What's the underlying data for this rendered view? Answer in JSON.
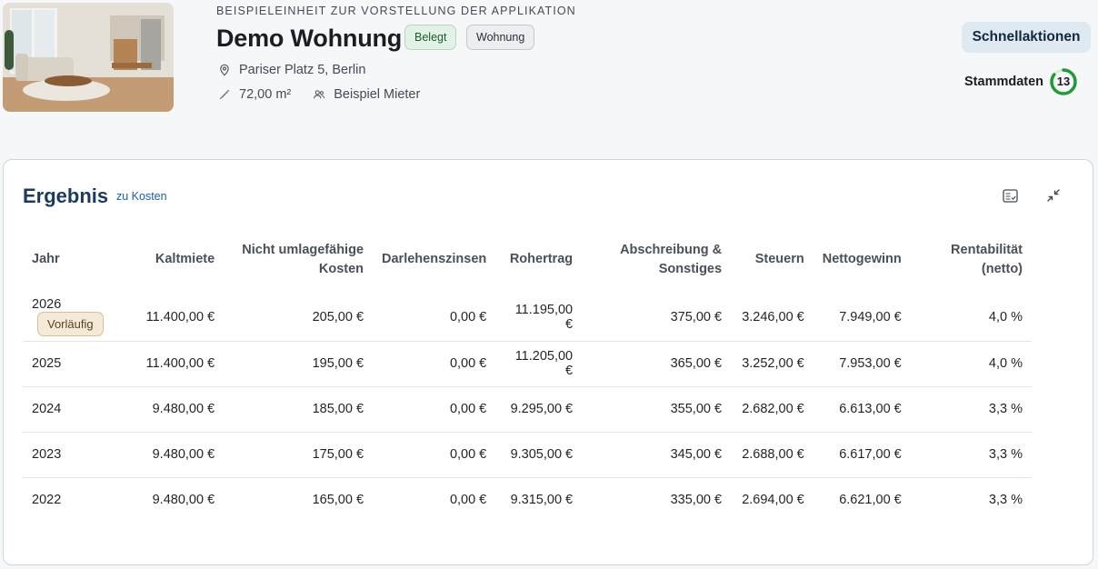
{
  "header": {
    "eyebrow": "BEISPIELEINHEIT ZUR VORSTELLUNG DER APPLIKATION",
    "title": "Demo Wohnung",
    "badges": {
      "status": "Belegt",
      "type": "Wohnung"
    },
    "address": "Pariser Platz 5, Berlin",
    "size": "72,00 m²",
    "tenant": "Beispiel Mieter",
    "quick_actions_label": "Schnellaktionen",
    "master_data_label": "Stammdaten",
    "master_data_count": "13",
    "master_data_progress": 0.85
  },
  "card": {
    "title": "Ergebnis",
    "link": "zu Kosten"
  },
  "table": {
    "headers": {
      "year": "Jahr",
      "rent": "Kaltmiete",
      "nonalloc_1": "Nicht umlagefähige",
      "nonalloc_2": "Kosten",
      "interest": "Darlehenszinsen",
      "gross": "Rohertrag",
      "depr_1": "Abschreibung &",
      "depr_2": "Sonstiges",
      "taxes": "Steuern",
      "net": "Nettogewinn",
      "yield_1": "Rentabilität",
      "yield_2": "(netto)"
    },
    "rows": [
      {
        "year": "2026",
        "badge": "Vorläufig",
        "rent": "11.400,00 €",
        "nonalloc": "205,00 €",
        "interest": "0,00 €",
        "gross": "11.195,00 €",
        "depr": "375,00 €",
        "taxes": "3.246,00 €",
        "net": "7.949,00 €",
        "yield": "4,0 %"
      },
      {
        "year": "2025",
        "rent": "11.400,00 €",
        "nonalloc": "195,00 €",
        "interest": "0,00 €",
        "gross": "11.205,00 €",
        "depr": "365,00 €",
        "taxes": "3.252,00 €",
        "net": "7.953,00 €",
        "yield": "4,0 %"
      },
      {
        "year": "2024",
        "rent": "9.480,00 €",
        "nonalloc": "185,00 €",
        "interest": "0,00 €",
        "gross": "9.295,00 €",
        "depr": "355,00 €",
        "taxes": "2.682,00 €",
        "net": "6.613,00 €",
        "yield": "3,3 %"
      },
      {
        "year": "2023",
        "rent": "9.480,00 €",
        "nonalloc": "175,00 €",
        "interest": "0,00 €",
        "gross": "9.305,00 €",
        "depr": "345,00 €",
        "taxes": "2.688,00 €",
        "net": "6.617,00 €",
        "yield": "3,3 %"
      },
      {
        "year": "2022",
        "rent": "9.480,00 €",
        "nonalloc": "165,00 €",
        "interest": "0,00 €",
        "gross": "9.315,00 €",
        "depr": "335,00 €",
        "taxes": "2.694,00 €",
        "net": "6.621,00 €",
        "yield": "3,3 %"
      }
    ]
  },
  "icons": {
    "location": "map-pin-icon",
    "size": "ruler-icon",
    "tenant": "people-icon",
    "chart_toggle": "chart-list-icon",
    "collapse": "collapse-icon"
  },
  "colors": {
    "accent_ring": "#1f9a3a",
    "title_blue": "#1c3a5e"
  }
}
